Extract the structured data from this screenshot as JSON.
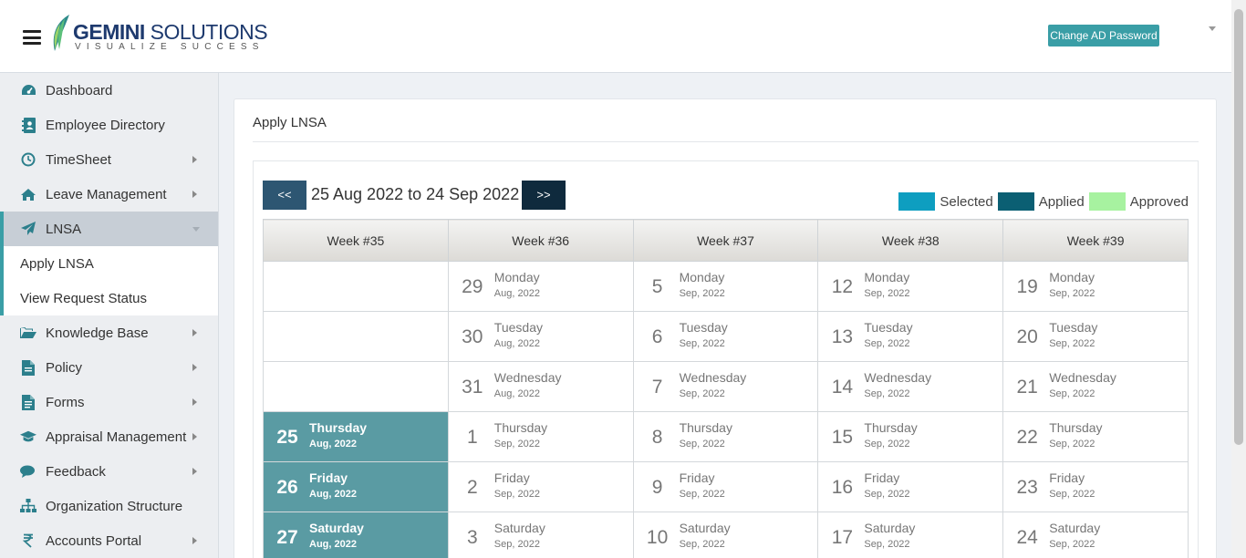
{
  "header": {
    "logo": {
      "name_bold": "GEMINI",
      "name_rest": " SOLUTIONS",
      "tagline": "VISUALIZE SUCCESS"
    },
    "change_password_label": "Change AD Password"
  },
  "sidebar": {
    "items": [
      {
        "label": "Dashboard",
        "icon": "dashboard-icon",
        "has_arrow": false
      },
      {
        "label": "Employee Directory",
        "icon": "address-book-icon",
        "has_arrow": false
      },
      {
        "label": "TimeSheet",
        "icon": "clock-icon",
        "has_arrow": true
      },
      {
        "label": "Leave Management",
        "icon": "home-icon",
        "has_arrow": true
      },
      {
        "label": "LNSA",
        "icon": "paper-plane-icon",
        "has_arrow": true,
        "active": true
      },
      {
        "label": "Knowledge Base",
        "icon": "folder-open-icon",
        "has_arrow": true
      },
      {
        "label": "Policy",
        "icon": "file-icon",
        "has_arrow": true
      },
      {
        "label": "Forms",
        "icon": "file-text-icon",
        "has_arrow": true
      },
      {
        "label": "Appraisal Management",
        "icon": "graduation-cap-icon",
        "has_arrow": true
      },
      {
        "label": "Feedback",
        "icon": "comments-icon",
        "has_arrow": true
      },
      {
        "label": "Organization Structure",
        "icon": "sitemap-icon",
        "has_arrow": false
      },
      {
        "label": "Accounts Portal",
        "icon": "rupee-icon",
        "has_arrow": true
      }
    ],
    "lnsa_sub": [
      "Apply LNSA",
      "View Request Status"
    ]
  },
  "main": {
    "title": "Apply LNSA",
    "prev_label": "<<",
    "next_label": ">>",
    "range_label": "25 Aug 2022 to 24 Sep 2022",
    "legend": [
      {
        "label": "Selected",
        "color": "#0e9ec0"
      },
      {
        "label": "Applied",
        "color": "#0b5f73"
      },
      {
        "label": "Approved",
        "color": "#a7f2a0"
      }
    ],
    "weeks": [
      "Week #35",
      "Week #36",
      "Week #37",
      "Week #38",
      "Week #39"
    ],
    "rows": [
      [
        null,
        {
          "day": "29",
          "name": "Monday",
          "sub": "Aug, 2022"
        },
        {
          "day": "5",
          "name": "Monday",
          "sub": "Sep, 2022"
        },
        {
          "day": "12",
          "name": "Monday",
          "sub": "Sep, 2022"
        },
        {
          "day": "19",
          "name": "Monday",
          "sub": "Sep, 2022"
        }
      ],
      [
        null,
        {
          "day": "30",
          "name": "Tuesday",
          "sub": "Aug, 2022"
        },
        {
          "day": "6",
          "name": "Tuesday",
          "sub": "Sep, 2022"
        },
        {
          "day": "13",
          "name": "Tuesday",
          "sub": "Sep, 2022"
        },
        {
          "day": "20",
          "name": "Tuesday",
          "sub": "Sep, 2022"
        }
      ],
      [
        null,
        {
          "day": "31",
          "name": "Wednesday",
          "sub": "Aug, 2022"
        },
        {
          "day": "7",
          "name": "Wednesday",
          "sub": "Sep, 2022"
        },
        {
          "day": "14",
          "name": "Wednesday",
          "sub": "Sep, 2022"
        },
        {
          "day": "21",
          "name": "Wednesday",
          "sub": "Sep, 2022"
        }
      ],
      [
        {
          "day": "25",
          "name": "Thursday",
          "sub": "Aug, 2022",
          "selected": true
        },
        {
          "day": "1",
          "name": "Thursday",
          "sub": "Sep, 2022"
        },
        {
          "day": "8",
          "name": "Thursday",
          "sub": "Sep, 2022"
        },
        {
          "day": "15",
          "name": "Thursday",
          "sub": "Sep, 2022"
        },
        {
          "day": "22",
          "name": "Thursday",
          "sub": "Sep, 2022"
        }
      ],
      [
        {
          "day": "26",
          "name": "Friday",
          "sub": "Aug, 2022",
          "selected": true
        },
        {
          "day": "2",
          "name": "Friday",
          "sub": "Sep, 2022"
        },
        {
          "day": "9",
          "name": "Friday",
          "sub": "Sep, 2022"
        },
        {
          "day": "16",
          "name": "Friday",
          "sub": "Sep, 2022"
        },
        {
          "day": "23",
          "name": "Friday",
          "sub": "Sep, 2022"
        }
      ],
      [
        {
          "day": "27",
          "name": "Saturday",
          "sub": "Aug, 2022",
          "selected": true
        },
        {
          "day": "3",
          "name": "Saturday",
          "sub": "Sep, 2022"
        },
        {
          "day": "10",
          "name": "Saturday",
          "sub": "Sep, 2022"
        },
        {
          "day": "17",
          "name": "Saturday",
          "sub": "Sep, 2022"
        },
        {
          "day": "24",
          "name": "Saturday",
          "sub": "Sep, 2022"
        }
      ]
    ]
  }
}
